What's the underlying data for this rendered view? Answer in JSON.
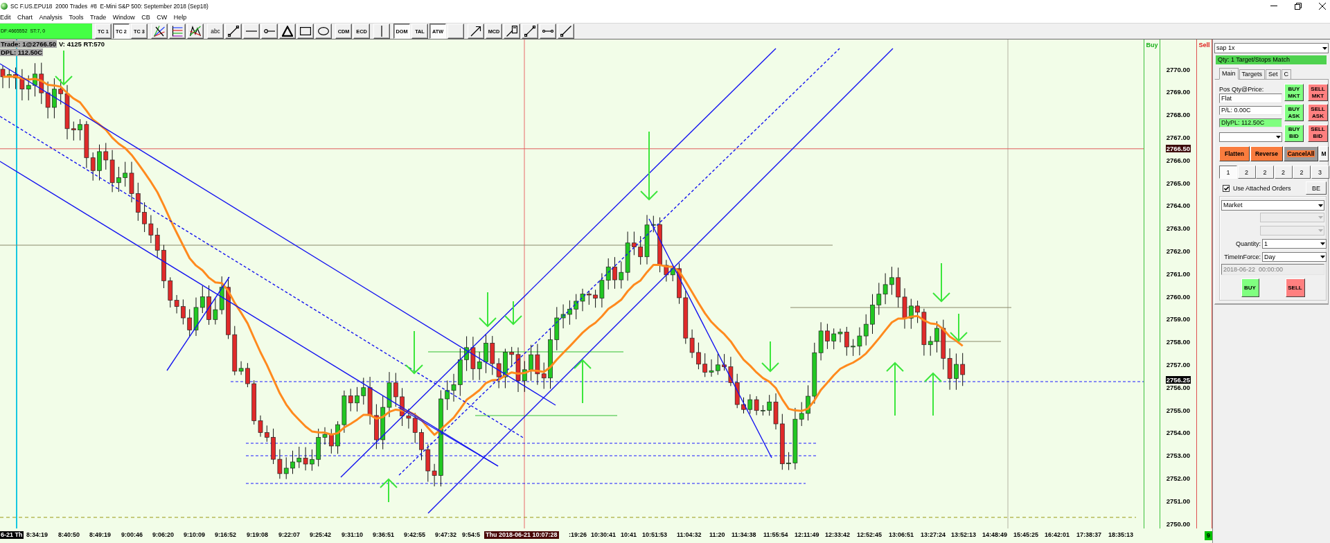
{
  "window": {
    "title": "SC F.US.EPU18  2000 Trades  #8  E-Mini S&P 500: September 2018 (Sep18)"
  },
  "menu": [
    "Edit",
    "Chart",
    "Analysis",
    "Tools",
    "Trade",
    "Window",
    "CB",
    "CW",
    "Help"
  ],
  "toolbar": {
    "status": "DF:4665552  ST:7, 0",
    "buttons": [
      {
        "kind": "text",
        "label": "TC 1",
        "pressed": false
      },
      {
        "kind": "text",
        "label": "TC 2",
        "pressed": true
      },
      {
        "kind": "text",
        "label": "TC 3",
        "pressed": false
      },
      {
        "kind": "tool",
        "pressed": false
      },
      {
        "kind": "tool",
        "pressed": false
      },
      {
        "kind": "tool",
        "pressed": false
      },
      {
        "kind": "text",
        "label": "abc",
        "pressed": false
      },
      {
        "kind": "tool",
        "pressed": false
      },
      {
        "kind": "tool",
        "pressed": false
      },
      {
        "kind": "tool",
        "pressed": false
      },
      {
        "kind": "tool",
        "pressed": false
      },
      {
        "kind": "tool",
        "pressed": false
      },
      {
        "kind": "tool",
        "pressed": false
      },
      {
        "kind": "text",
        "label": "CDM",
        "pressed": false
      },
      {
        "kind": "text",
        "label": "ECD",
        "pressed": false
      },
      {
        "kind": "tool",
        "pressed": false
      },
      {
        "kind": "text",
        "label": "DOM",
        "pressed": true
      },
      {
        "kind": "text",
        "label": "TAL",
        "pressed": false
      },
      {
        "kind": "text",
        "label": "ATW",
        "pressed": true
      },
      {
        "kind": "blank",
        "pressed": false
      },
      {
        "kind": "tool",
        "pressed": false
      },
      {
        "kind": "text",
        "label": "MCD",
        "pressed": false
      },
      {
        "kind": "tool",
        "pressed": false
      },
      {
        "kind": "tool",
        "pressed": false
      },
      {
        "kind": "tool",
        "pressed": false
      },
      {
        "kind": "tool",
        "pressed": false
      }
    ]
  },
  "chart": {
    "info": {
      "trade": "Trade: 1@2766.50",
      "volume": "V: 4125 RT:570",
      "daily_pl": "DPL: 112.50C"
    },
    "buy_label": "Buy",
    "sell_label": "Sell",
    "price_labels": [
      "2770.00",
      "2769.00",
      "2768.00",
      "2767.00",
      "2766.00",
      "2765.00",
      "2764.00",
      "2763.00",
      "2762.00",
      "2761.00",
      "2760.00",
      "2759.00",
      "2758.00",
      "2757.00",
      "2756.00",
      "2755.00",
      "2754.00",
      "2753.00",
      "2752.00",
      "2751.00",
      "2750.00"
    ],
    "price_markers": [
      "2766.50",
      "2756.25"
    ]
  },
  "time_axis": {
    "session_label": "6-21 Th",
    "labels": [
      "8:34:19",
      "8:40:50",
      "8:49:19",
      "9:00:46",
      "9:06:20",
      "9:10:09",
      "9:16:52",
      "9:19:08",
      "9:22:07",
      "9:25:42",
      "9:31:10",
      "9:36:51",
      "9:42:55",
      "9:47:32",
      "9:54:5",
      ":19:26",
      "10:30:41",
      "10:41",
      "10:51:53",
      "11:04:32",
      "11:20",
      "11:34:38",
      "11:55:54",
      "12:11:49",
      "12:33:42",
      "12:52:45",
      "13:06:51",
      "13:27:24",
      "13:52:13",
      "14:48:49",
      "15:45:25",
      "16:42:01",
      "17:38:37",
      "18:35:13"
    ],
    "cursor_label": "Thu 2018-06-21  10:07:28",
    "corner_badge": "9"
  },
  "trade_panel": {
    "account": "sap 1x",
    "status": "Qty: 1 Target/Stops Match",
    "tabs": [
      {
        "label": "Main",
        "selected": true
      },
      {
        "label": "Targets",
        "selected": false
      },
      {
        "label": "Set",
        "selected": false
      },
      {
        "label": "C",
        "selected": false
      }
    ],
    "position_label": "Pos Qty@Price:",
    "position": "Flat",
    "pl": "P/L: 0.00C",
    "daily_pl": "DlyPL: 112.50C",
    "order_buttons": [
      {
        "label": "BUY MKT",
        "kind": "buy"
      },
      {
        "label": "SELL MKT",
        "kind": "sell"
      },
      {
        "label": "BUY ASK",
        "kind": "buy"
      },
      {
        "label": "SELL ASK",
        "kind": "sell"
      },
      {
        "label": "BUY BID",
        "kind": "buy"
      },
      {
        "label": "SELL BID",
        "kind": "sell"
      }
    ],
    "action_buttons": [
      {
        "label": "Flatten",
        "kind": "action"
      },
      {
        "label": "Reverse",
        "kind": "action"
      },
      {
        "label": "CancelAll",
        "kind": "focused"
      },
      {
        "label": "M",
        "kind": "plain"
      }
    ],
    "target_tabs": [
      {
        "label": "1",
        "selected": true
      },
      {
        "label": "2",
        "selected": false
      },
      {
        "label": "2",
        "selected": false
      },
      {
        "label": "2",
        "selected": false
      },
      {
        "label": "2",
        "selected": false
      },
      {
        "label": "3",
        "selected": false
      }
    ],
    "attached_orders": {
      "label": "Use Attached Orders",
      "checked": true
    },
    "be_button": "BE",
    "order_type": "Market",
    "extra_selects": [
      {
        "disabled": true
      },
      {
        "disabled": true
      }
    ],
    "quantity": {
      "label": "Quantity:",
      "value": "1"
    },
    "time_in_force": {
      "label": "TimeInForce:",
      "value": "Day"
    },
    "expiry": {
      "value": "2018-06-22  00:00:00",
      "disabled": true
    },
    "submit_buttons": [
      {
        "label": "BUY",
        "kind": "buy"
      },
      {
        "label": "SELL",
        "kind": "sell"
      }
    ]
  }
}
